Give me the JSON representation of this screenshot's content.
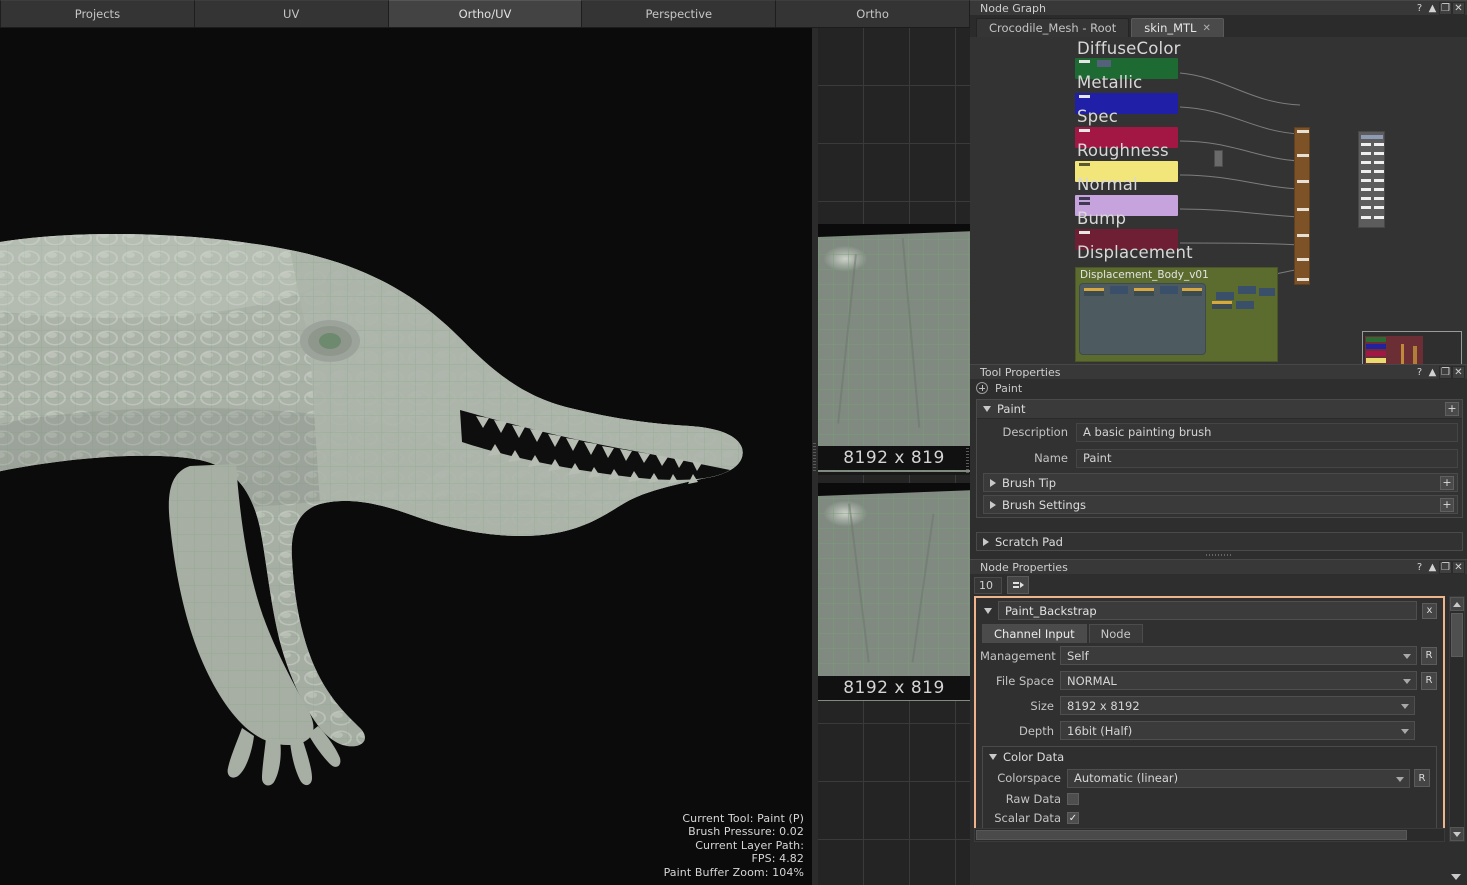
{
  "viewport_tabs": [
    {
      "label": "Projects",
      "active": false
    },
    {
      "label": "UV",
      "active": false
    },
    {
      "label": "Ortho/UV",
      "active": true
    },
    {
      "label": "Perspective",
      "active": false
    },
    {
      "label": "Ortho",
      "active": false
    }
  ],
  "hud": {
    "lines": [
      "Current Tool: Paint (P)",
      "Brush Pressure: 0.02",
      "Current Layer Path:",
      "FPS: 4.82",
      "Paint Buffer Zoom: 104%"
    ]
  },
  "uv_panel": {
    "tile_label_1": "8192 x 819",
    "tile_label_2": "8192 x 819"
  },
  "node_graph": {
    "title": "Node Graph",
    "window_buttons": [
      "?",
      "▲",
      "❐",
      "✕"
    ],
    "tabs": [
      {
        "label": "Crocodile_Mesh - Root",
        "active": false,
        "closable": false
      },
      {
        "label": "skin_MTL",
        "active": true,
        "closable": true,
        "close_glyph": "✕"
      }
    ],
    "channels": [
      {
        "name": "DiffuseColor",
        "color": "#1d6b33"
      },
      {
        "name": "Metallic",
        "color": "#1f1fa8"
      },
      {
        "name": "Spec",
        "color": "#a31745"
      },
      {
        "name": "Roughness",
        "color": "#f2e67a"
      },
      {
        "name": "Normal",
        "color": "#c6a3dd"
      },
      {
        "name": "Bump",
        "color": "#6e1f33"
      },
      {
        "name": "Displacement",
        "color": "#5c6b2e"
      }
    ],
    "group_node": {
      "label": "Displacement_Body_v01",
      "color": "#5c6b2e"
    },
    "output_node": {
      "color": "#7d5226"
    }
  },
  "tool_properties": {
    "title": "Tool Properties",
    "window_buttons": [
      "?",
      "▲",
      "❐",
      "✕"
    ],
    "tool_name": "Paint",
    "tool_icon": "plus-circle-icon",
    "paint_group": {
      "label": "Paint",
      "expanded": true,
      "add_label": "+",
      "fields": [
        {
          "label": "Description",
          "value": "A basic painting brush"
        },
        {
          "label": "Name",
          "value": "Paint"
        }
      ]
    },
    "brush_tip": {
      "label": "Brush Tip",
      "expanded": false,
      "add_label": "+"
    },
    "brush_settings": {
      "label": "Brush Settings",
      "expanded": false,
      "add_label": "+"
    },
    "scratch_pad": {
      "label": "Scratch Pad",
      "expanded": false
    }
  },
  "node_properties": {
    "title": "Node Properties",
    "window_buttons": [
      "?",
      "▲",
      "❐",
      "✕"
    ],
    "pin_count": "10",
    "pin_button_icon": "unpin-icon",
    "node_name": "Paint_Backstrap",
    "close_label": "x",
    "tabs": [
      {
        "label": "Channel Input",
        "active": true
      },
      {
        "label": "Node",
        "active": false
      }
    ],
    "fields": [
      {
        "label": "Management",
        "value": "Self",
        "reset": "R",
        "type": "combo"
      },
      {
        "label": "File Space",
        "value": "NORMAL",
        "reset": "R",
        "type": "combo"
      },
      {
        "label": "Size",
        "value": "8192 x 8192",
        "reset": "",
        "type": "combo"
      },
      {
        "label": "Depth",
        "value": "16bit (Half)",
        "reset": "",
        "type": "combo"
      }
    ],
    "color_data": {
      "label": "Color Data",
      "expanded": true,
      "colorspace": {
        "label": "Colorspace",
        "value": "Automatic (linear)",
        "reset": "R"
      },
      "raw_data": {
        "label": "Raw Data",
        "checked": false,
        "check_glyph": ""
      },
      "scalar_data": {
        "label": "Scalar Data",
        "checked": true,
        "check_glyph": "✓"
      }
    },
    "selection_highlight_color": "#f0b48c"
  }
}
